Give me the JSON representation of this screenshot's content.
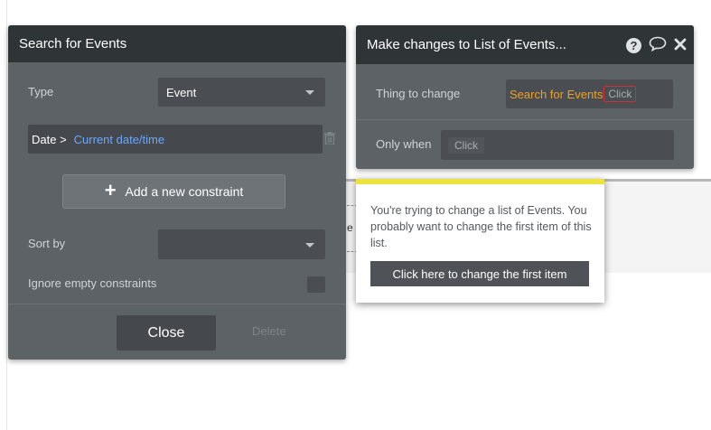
{
  "background": {
    "canvas_fragment_text": "e"
  },
  "search_panel": {
    "title": "Search for Events",
    "type_label": "Type",
    "type_value": "Event",
    "constraint": {
      "field": "Date >",
      "value": "Current date/time"
    },
    "add_constraint_label": "Add a new constraint",
    "sort_by_label": "Sort by",
    "sort_by_value": "",
    "ignore_empty_label": "Ignore empty constraints",
    "ignore_empty_checked": false,
    "close_label": "Close",
    "delete_label": "Delete"
  },
  "action_panel": {
    "title": "Make changes to List of Events...",
    "icons": [
      "help-icon",
      "comment-icon",
      "close-icon"
    ],
    "thing_to_change_label": "Thing to change",
    "thing_source": "Search for Events",
    "thing_chip": "Click",
    "only_when_label": "Only when",
    "only_when_chip": "Click"
  },
  "tooltip": {
    "message": "You're trying to change a list of Events. You probably want to change the first item of this list.",
    "cta_label": "Click here to change the first item",
    "accent_color": "#ece341"
  },
  "colors": {
    "panel_bg": "#5d6266",
    "header_bg": "#2f3437",
    "link_blue": "#6aa8ff",
    "source_orange": "#f0a020",
    "error_red": "#cc2e3a"
  }
}
